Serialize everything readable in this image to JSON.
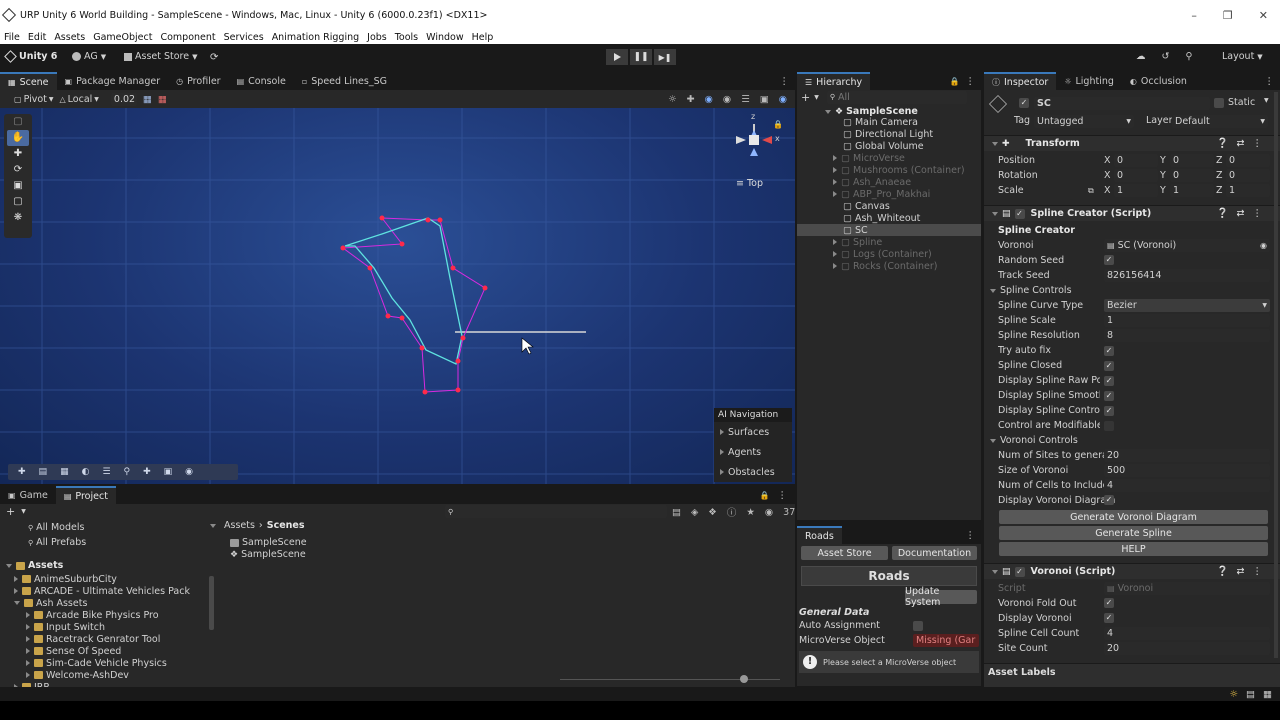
{
  "window": {
    "title": "URP Unity 6 World Building - SampleScene - Windows, Mac, Linux - Unity 6 (6000.0.23f1) <DX11>"
  },
  "menu": [
    "File",
    "Edit",
    "Assets",
    "GameObject",
    "Component",
    "Services",
    "Animation Rigging",
    "Jobs",
    "Tools",
    "Window",
    "Help"
  ],
  "toolbar": {
    "brand": "Unity 6",
    "account": "AG",
    "asset_store": "Asset Store",
    "layout": "Layout"
  },
  "scene_tabs": [
    "Scene",
    "Package Manager",
    "Profiler",
    "Console",
    "Speed Lines_SG"
  ],
  "scene_toolbar": {
    "pivot": "Pivot",
    "space": "Local",
    "snap": "0.02"
  },
  "gizmo": {
    "view": "Top",
    "x": "x",
    "z": "z"
  },
  "ai_nav": {
    "title": "AI Navigation",
    "items": [
      "Surfaces",
      "Agents",
      "Obstacles"
    ]
  },
  "hierarchy": {
    "tab": "Hierarchy",
    "search_placeholder": "All",
    "scene": "SampleScene",
    "items": [
      {
        "label": "Main Camera",
        "dim": false
      },
      {
        "label": "Directional Light",
        "dim": false
      },
      {
        "label": "Global Volume",
        "dim": false
      },
      {
        "label": "MicroVerse",
        "dim": true
      },
      {
        "label": "Mushrooms (Container)",
        "dim": true
      },
      {
        "label": "Ash_Anaeae",
        "dim": true
      },
      {
        "label": "ABP_Pro_Makhai",
        "dim": true
      },
      {
        "label": "Canvas",
        "dim": false
      },
      {
        "label": "Ash_Whiteout",
        "dim": false
      },
      {
        "label": "SC",
        "dim": false
      },
      {
        "label": "Spline",
        "dim": true
      },
      {
        "label": "Logs (Container)",
        "dim": true
      },
      {
        "label": "Rocks (Container)",
        "dim": true
      }
    ]
  },
  "inspector_tabs": [
    "Inspector",
    "Lighting",
    "Occlusion"
  ],
  "inspector": {
    "name": "SC",
    "static_label": "Static",
    "tag_label": "Tag",
    "tag": "Untagged",
    "layer_label": "Layer",
    "layer": "Default",
    "transform": {
      "title": "Transform",
      "rows": [
        {
          "label": "Position",
          "x": "0",
          "y": "0",
          "z": "0"
        },
        {
          "label": "Rotation",
          "x": "0",
          "y": "0",
          "z": "0"
        },
        {
          "label": "Scale",
          "x": "1",
          "y": "1",
          "z": "1"
        }
      ]
    },
    "spline_creator": {
      "title": "Spline Creator (Script)",
      "section": "Spline Creator",
      "voronoi_label": "Voronoi",
      "voronoi_value": "SC (Voronoi)",
      "random_seed_label": "Random Seed",
      "track_seed_label": "Track Seed",
      "track_seed": "826156414",
      "spline_controls": "Spline Controls",
      "curve_type_label": "Spline Curve Type",
      "curve_type": "Bezier",
      "scale_label": "Spline Scale",
      "scale": "1",
      "resolution_label": "Spline Resolution",
      "resolution": "8",
      "checks": [
        "Try auto fix",
        "Spline Closed",
        "Display Spline Raw Point",
        "Display Spline Smooth P",
        "Display Spline Control P",
        "Control are Modifiable"
      ],
      "voronoi_controls": "Voronoi Controls",
      "sites_label": "Num of Sites to generat",
      "sites": "20",
      "size_label": "Size of Voronoi",
      "size": "500",
      "cells_label": "Num of Cells to Include i",
      "cells": "4",
      "display_diagram_label": "Display Voronoi Diagram",
      "btn_diagram": "Generate Voronoi Diagram",
      "btn_spline": "Generate Spline",
      "btn_help": "HELP"
    },
    "voronoi": {
      "title": "Voronoi (Script)",
      "script_label": "Script",
      "script_value": "Voronoi",
      "fold_label": "Voronoi Fold Out",
      "display_label": "Display Voronoi",
      "cell_count_label": "Spline Cell Count",
      "cell_count": "4",
      "site_count_label": "Site Count",
      "site_count": "20"
    },
    "asset_labels": "Asset Labels"
  },
  "roads": {
    "tab": "Roads",
    "btn_asset_store": "Asset Store",
    "btn_docs": "Documentation",
    "header": "Roads",
    "btn_update": "Update System",
    "general": "General Data",
    "auto_label": "Auto Assignment",
    "mv_label": "MicroVerse Object",
    "mv_value": "Missing (Gar",
    "warning": "Please select a MicroVerse object"
  },
  "bottom_tabs": [
    "Game",
    "Project"
  ],
  "project": {
    "favorites": [
      "All Models",
      "All Prefabs"
    ],
    "root": "Assets",
    "tree": [
      {
        "label": "AnimeSuburbCity",
        "indent": 1
      },
      {
        "label": "ARCADE - Ultimate Vehicles Pack",
        "indent": 1
      },
      {
        "label": "Ash Assets",
        "indent": 1
      },
      {
        "label": "Arcade Bike Physics Pro",
        "indent": 2
      },
      {
        "label": "Input Switch",
        "indent": 2
      },
      {
        "label": "Racetrack Genrator Tool",
        "indent": 2
      },
      {
        "label": "Sense Of Speed",
        "indent": 2
      },
      {
        "label": "Sim-Cade Vehicle Physics",
        "indent": 2
      },
      {
        "label": "Welcome-AshDev",
        "indent": 2
      },
      {
        "label": "IRP",
        "indent": 1
      }
    ],
    "breadcrumb": [
      "Assets",
      "Scenes"
    ],
    "files": [
      "SampleScene",
      "SampleScene"
    ],
    "count": "37"
  },
  "colors": {
    "accent": "#3a79bb",
    "spline_cyan": "#5fe3e0",
    "control_magenta": "#d82ae0"
  }
}
